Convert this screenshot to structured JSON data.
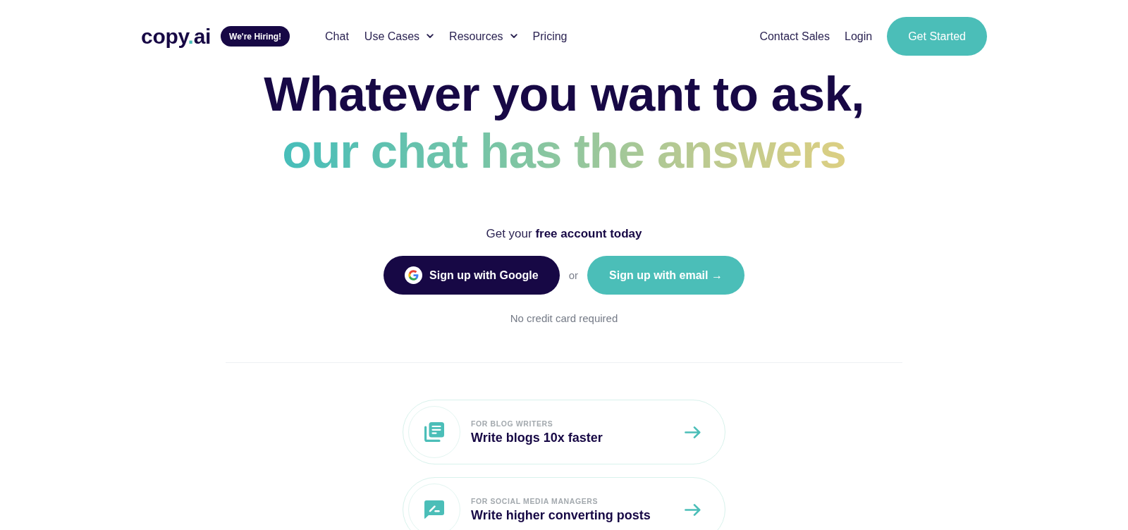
{
  "nav": {
    "logo": [
      {
        "kind": "word",
        "text": "copy"
      },
      {
        "kind": "dot",
        "text": "."
      },
      {
        "kind": "word",
        "text": "ai"
      }
    ],
    "badge": "We're Hiring!",
    "links": [
      {
        "label": "Chat",
        "dropdown": false
      },
      {
        "label": "Use Cases",
        "dropdown": true
      },
      {
        "label": "Resources",
        "dropdown": true
      },
      {
        "label": "Pricing",
        "dropdown": false
      }
    ],
    "right_links": [
      "Contact Sales",
      "Login"
    ],
    "cta": "Get Started"
  },
  "hero": {
    "headline": "Whatever you want to ask,",
    "headline_accent": "our chat has the answers",
    "prompt": "Get your **free account today**",
    "buttons": [
      {
        "kind": "google",
        "label": "Sign up with Google"
      },
      {
        "kind": "email",
        "label": "Sign up with email →"
      }
    ],
    "separator": "or",
    "note": "No credit card required"
  },
  "cards": [
    {
      "kind": "blog",
      "eyebrow": "FOR BLOG WRITERS",
      "title": "Write blogs 10x faster"
    },
    {
      "kind": "social",
      "eyebrow": "FOR SOCIAL MEDIA MANAGERS",
      "title": "Write higher converting posts"
    }
  ]
}
